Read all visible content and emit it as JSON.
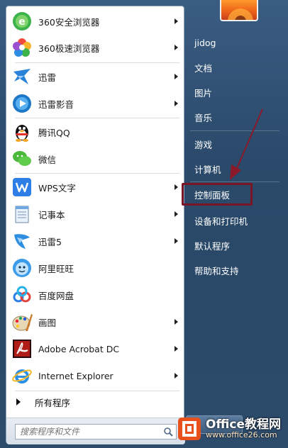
{
  "programs": [
    {
      "label": "360安全浏览器",
      "icon": "360-safe-browser-icon",
      "submenu": true
    },
    {
      "label": "360极速浏览器",
      "icon": "360-speed-browser-icon",
      "submenu": true
    },
    {
      "label": "迅雷",
      "icon": "thunder-icon",
      "submenu": true
    },
    {
      "label": "迅雷影音",
      "icon": "thunder-player-icon",
      "submenu": true
    },
    {
      "label": "腾讯QQ",
      "icon": "qq-penguin-icon",
      "submenu": false
    },
    {
      "label": "微信",
      "icon": "wechat-icon",
      "submenu": false
    },
    {
      "label": "WPS文字",
      "icon": "wps-writer-icon",
      "submenu": true
    },
    {
      "label": "记事本",
      "icon": "notepad-icon",
      "submenu": true
    },
    {
      "label": "迅雷5",
      "icon": "thunder5-icon",
      "submenu": true
    },
    {
      "label": "阿里旺旺",
      "icon": "aliwangwang-icon",
      "submenu": false
    },
    {
      "label": "百度网盘",
      "icon": "baidu-netdisk-icon",
      "submenu": false
    },
    {
      "label": "画图",
      "icon": "paint-icon",
      "submenu": true
    },
    {
      "label": "Adobe Acrobat DC",
      "icon": "acrobat-icon",
      "submenu": true
    },
    {
      "label": "Internet Explorer",
      "icon": "internet-explorer-icon",
      "submenu": true
    }
  ],
  "all_programs": "所有程序",
  "search": {
    "placeholder": "搜索程序和文件"
  },
  "right_items": [
    {
      "label": "jidog"
    },
    {
      "label": "文档"
    },
    {
      "label": "图片"
    },
    {
      "label": "音乐"
    },
    {
      "label": "游戏"
    },
    {
      "label": "计算机"
    },
    {
      "label": "控制面板"
    },
    {
      "label": "设备和打印机"
    },
    {
      "label": "默认程序"
    },
    {
      "label": "帮助和支持"
    }
  ],
  "watermark": {
    "title": "Office教程网",
    "url": "www.office26.com"
  },
  "colors": {
    "highlight": "#7a1525",
    "arrow": "#8a1a2a"
  }
}
